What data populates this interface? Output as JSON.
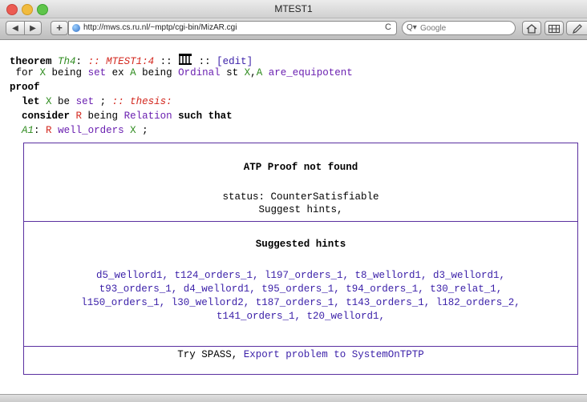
{
  "window": {
    "title": "MTEST1"
  },
  "toolbar": {
    "back_icon": "◀",
    "forward_icon": "▶",
    "add_icon": "+",
    "url": "http://mws.cs.ru.nl/~mptp/cgi-bin/MizAR.cgi",
    "reload_icon": "C",
    "search_icon": "Q▾",
    "search_placeholder": "Google"
  },
  "code": {
    "l1": {
      "kw": "theorem",
      "label": "Th4",
      "colon": ": ",
      "sep1": ":: ",
      "ref": "MTEST1:4",
      "sep2": " :: ",
      "sep3": " :: ",
      "edit": "[edit]"
    },
    "l2": {
      "for": "for ",
      "X": "X",
      "being1": " being ",
      "set": "set",
      "ex": " ex ",
      "A": "A",
      "being2": " being ",
      "ordinal": "Ordinal",
      "st": " st ",
      "X2": "X",
      "comma": ",",
      "A2": "A",
      "equi": " are_equipotent"
    },
    "l3": {
      "kw": "proof"
    },
    "l4": {
      "let": "let",
      "X": " X",
      "be": " be ",
      "set": "set",
      "semi": " ; ",
      "comment": ":: thesis:"
    },
    "l5": {
      "consider": "consider",
      "R": " R",
      "being": " being ",
      "relation": "Relation",
      "such": " such that"
    },
    "l6": {
      "label": "A1",
      "colon": ": ",
      "R": "R",
      "wo": " well_orders",
      "X": " X",
      "semi": " ;"
    }
  },
  "proof_box": {
    "atp_title": "ATP Proof not found",
    "status": "status: CounterSatisfiable",
    "suggest": "Suggest hints,",
    "hints_title": "Suggested hints",
    "hints": [
      "d5_wellord1, t124_orders_1, l197_orders_1, t8_wellord1, d3_wellord1,",
      "t93_orders_1, d4_wellord1, t95_orders_1, t94_orders_1, t30_relat_1,",
      "l150_orders_1, l30_wellord2, t187_orders_1, t143_orders_1, l182_orders_2,",
      "t141_orders_1, t20_wellord1,"
    ],
    "try_prefix": "Try",
    "spass_link": "SPASS",
    "export_link": "Export problem to SystemOnTPTP"
  }
}
